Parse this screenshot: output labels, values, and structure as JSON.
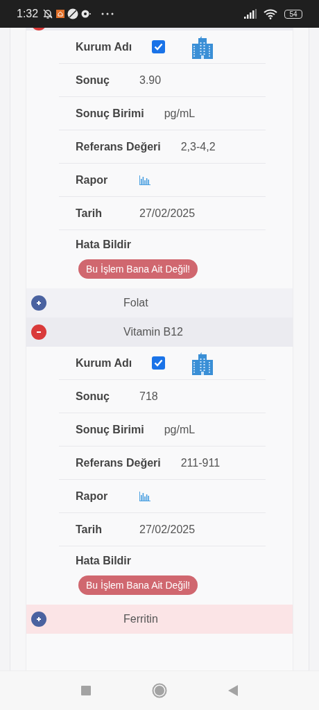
{
  "status_bar": {
    "time": "1:32",
    "battery": "54"
  },
  "tests": [
    {
      "expanded": true,
      "color": "#ebebf0",
      "details": [
        {
          "kind": "institution",
          "label": "Kurum Adı",
          "checked": true
        },
        {
          "kind": "text",
          "label": "Sonuç",
          "value": "3.90"
        },
        {
          "kind": "text",
          "label": "Sonuç Birimi",
          "value": "pg/mL"
        },
        {
          "kind": "text",
          "label": "Referans Değeri",
          "value": "2,3-4,2"
        },
        {
          "kind": "report",
          "label": "Rapor"
        },
        {
          "kind": "text",
          "label": "Tarih",
          "value": "27/02/2025"
        },
        {
          "kind": "error",
          "label": "Hata Bildir",
          "button": "Bu İşlem Bana Ait Değil!"
        }
      ]
    },
    {
      "name": "Folat",
      "expanded": false,
      "color": "#f1f1f5"
    },
    {
      "name": "Vitamin B12",
      "expanded": true,
      "color": "#ebebf0",
      "details": [
        {
          "kind": "institution",
          "label": "Kurum Adı",
          "checked": true
        },
        {
          "kind": "text",
          "label": "Sonuç",
          "value": "718"
        },
        {
          "kind": "text",
          "label": "Sonuç Birimi",
          "value": "pg/mL"
        },
        {
          "kind": "text",
          "label": "Referans Değeri",
          "value": "211-911"
        },
        {
          "kind": "report",
          "label": "Rapor"
        },
        {
          "kind": "text",
          "label": "Tarih",
          "value": "27/02/2025"
        },
        {
          "kind": "error",
          "label": "Hata Bildir",
          "button": "Bu İşlem Bana Ait Değil!"
        }
      ]
    },
    {
      "name": "Ferritin",
      "expanded": false,
      "color": "#fbe4e6"
    }
  ]
}
